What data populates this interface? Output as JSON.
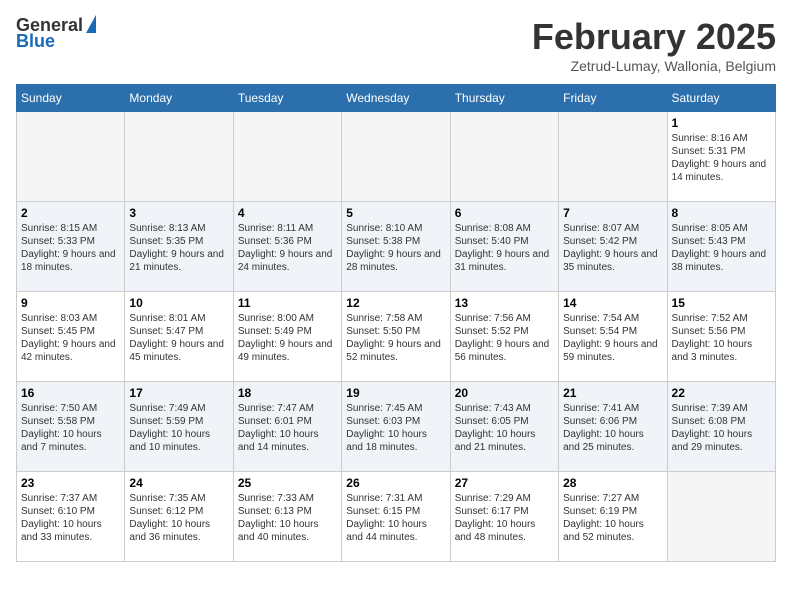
{
  "header": {
    "logo_general": "General",
    "logo_blue": "Blue",
    "month_title": "February 2025",
    "location": "Zetrud-Lumay, Wallonia, Belgium"
  },
  "days_of_week": [
    "Sunday",
    "Monday",
    "Tuesday",
    "Wednesday",
    "Thursday",
    "Friday",
    "Saturday"
  ],
  "weeks": [
    [
      {
        "day": "",
        "info": ""
      },
      {
        "day": "",
        "info": ""
      },
      {
        "day": "",
        "info": ""
      },
      {
        "day": "",
        "info": ""
      },
      {
        "day": "",
        "info": ""
      },
      {
        "day": "",
        "info": ""
      },
      {
        "day": "1",
        "info": "Sunrise: 8:16 AM\nSunset: 5:31 PM\nDaylight: 9 hours and 14 minutes."
      }
    ],
    [
      {
        "day": "2",
        "info": "Sunrise: 8:15 AM\nSunset: 5:33 PM\nDaylight: 9 hours and 18 minutes."
      },
      {
        "day": "3",
        "info": "Sunrise: 8:13 AM\nSunset: 5:35 PM\nDaylight: 9 hours and 21 minutes."
      },
      {
        "day": "4",
        "info": "Sunrise: 8:11 AM\nSunset: 5:36 PM\nDaylight: 9 hours and 24 minutes."
      },
      {
        "day": "5",
        "info": "Sunrise: 8:10 AM\nSunset: 5:38 PM\nDaylight: 9 hours and 28 minutes."
      },
      {
        "day": "6",
        "info": "Sunrise: 8:08 AM\nSunset: 5:40 PM\nDaylight: 9 hours and 31 minutes."
      },
      {
        "day": "7",
        "info": "Sunrise: 8:07 AM\nSunset: 5:42 PM\nDaylight: 9 hours and 35 minutes."
      },
      {
        "day": "8",
        "info": "Sunrise: 8:05 AM\nSunset: 5:43 PM\nDaylight: 9 hours and 38 minutes."
      }
    ],
    [
      {
        "day": "9",
        "info": "Sunrise: 8:03 AM\nSunset: 5:45 PM\nDaylight: 9 hours and 42 minutes."
      },
      {
        "day": "10",
        "info": "Sunrise: 8:01 AM\nSunset: 5:47 PM\nDaylight: 9 hours and 45 minutes."
      },
      {
        "day": "11",
        "info": "Sunrise: 8:00 AM\nSunset: 5:49 PM\nDaylight: 9 hours and 49 minutes."
      },
      {
        "day": "12",
        "info": "Sunrise: 7:58 AM\nSunset: 5:50 PM\nDaylight: 9 hours and 52 minutes."
      },
      {
        "day": "13",
        "info": "Sunrise: 7:56 AM\nSunset: 5:52 PM\nDaylight: 9 hours and 56 minutes."
      },
      {
        "day": "14",
        "info": "Sunrise: 7:54 AM\nSunset: 5:54 PM\nDaylight: 9 hours and 59 minutes."
      },
      {
        "day": "15",
        "info": "Sunrise: 7:52 AM\nSunset: 5:56 PM\nDaylight: 10 hours and 3 minutes."
      }
    ],
    [
      {
        "day": "16",
        "info": "Sunrise: 7:50 AM\nSunset: 5:58 PM\nDaylight: 10 hours and 7 minutes."
      },
      {
        "day": "17",
        "info": "Sunrise: 7:49 AM\nSunset: 5:59 PM\nDaylight: 10 hours and 10 minutes."
      },
      {
        "day": "18",
        "info": "Sunrise: 7:47 AM\nSunset: 6:01 PM\nDaylight: 10 hours and 14 minutes."
      },
      {
        "day": "19",
        "info": "Sunrise: 7:45 AM\nSunset: 6:03 PM\nDaylight: 10 hours and 18 minutes."
      },
      {
        "day": "20",
        "info": "Sunrise: 7:43 AM\nSunset: 6:05 PM\nDaylight: 10 hours and 21 minutes."
      },
      {
        "day": "21",
        "info": "Sunrise: 7:41 AM\nSunset: 6:06 PM\nDaylight: 10 hours and 25 minutes."
      },
      {
        "day": "22",
        "info": "Sunrise: 7:39 AM\nSunset: 6:08 PM\nDaylight: 10 hours and 29 minutes."
      }
    ],
    [
      {
        "day": "23",
        "info": "Sunrise: 7:37 AM\nSunset: 6:10 PM\nDaylight: 10 hours and 33 minutes."
      },
      {
        "day": "24",
        "info": "Sunrise: 7:35 AM\nSunset: 6:12 PM\nDaylight: 10 hours and 36 minutes."
      },
      {
        "day": "25",
        "info": "Sunrise: 7:33 AM\nSunset: 6:13 PM\nDaylight: 10 hours and 40 minutes."
      },
      {
        "day": "26",
        "info": "Sunrise: 7:31 AM\nSunset: 6:15 PM\nDaylight: 10 hours and 44 minutes."
      },
      {
        "day": "27",
        "info": "Sunrise: 7:29 AM\nSunset: 6:17 PM\nDaylight: 10 hours and 48 minutes."
      },
      {
        "day": "28",
        "info": "Sunrise: 7:27 AM\nSunset: 6:19 PM\nDaylight: 10 hours and 52 minutes."
      },
      {
        "day": "",
        "info": ""
      }
    ]
  ]
}
